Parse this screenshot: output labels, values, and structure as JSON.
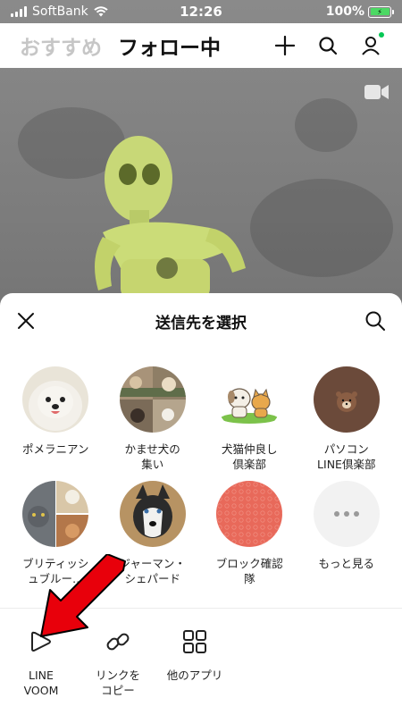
{
  "status_bar": {
    "carrier": "SoftBank",
    "time": "12:26",
    "battery": "100%"
  },
  "top_nav": {
    "tabs": [
      {
        "label": "おすすめ",
        "active": false
      },
      {
        "label": "フォロー中",
        "active": true
      }
    ],
    "icons": [
      "plus-icon",
      "search-icon",
      "profile-icon"
    ]
  },
  "sheet": {
    "title": "送信先を選択",
    "contacts": [
      {
        "name": "ポメラニアン",
        "avatar": "pomeranian-photo"
      },
      {
        "name": "かませ犬の集い",
        "avatar": "dog-collage-photo"
      },
      {
        "name": "犬猫仲良し倶楽部",
        "avatar": "dog-cat-illustration"
      },
      {
        "name": "パソコンLINE倶楽部",
        "avatar": "brown-bear-icon"
      },
      {
        "name": "ブリティッシュブルー…",
        "avatar": "cat-collage-photo"
      },
      {
        "name": "ジャーマン・シェパード",
        "avatar": "husky-photo"
      },
      {
        "name": "ブロック確認隊",
        "avatar": "red-pattern"
      },
      {
        "name": "もっと見る",
        "avatar": "more-icon"
      }
    ],
    "name_lines": [
      [
        "ポメラニアン"
      ],
      [
        "かませ犬の",
        "集い"
      ],
      [
        "犬猫仲良し",
        "倶楽部"
      ],
      [
        "パソコン",
        "LINE倶楽部"
      ],
      [
        "ブリティッシ",
        "ュブルー…"
      ],
      [
        "ジャーマン・",
        "シェパード"
      ],
      [
        "ブロック確認",
        "隊"
      ],
      [
        "もっと見る"
      ]
    ],
    "actions": [
      {
        "label_lines": [
          "LINE",
          "VOOM"
        ],
        "icon": "voom-icon"
      },
      {
        "label_lines": [
          "リンクを",
          "コピー"
        ],
        "icon": "link-icon"
      },
      {
        "label_lines": [
          "他のアプリ"
        ],
        "icon": "grid-icon"
      }
    ]
  },
  "colors": {
    "line_green": "#06c755",
    "arrow_red": "#e8000b",
    "block_avatar": "#e8695a",
    "bear_avatar": "#6b4a3a"
  }
}
